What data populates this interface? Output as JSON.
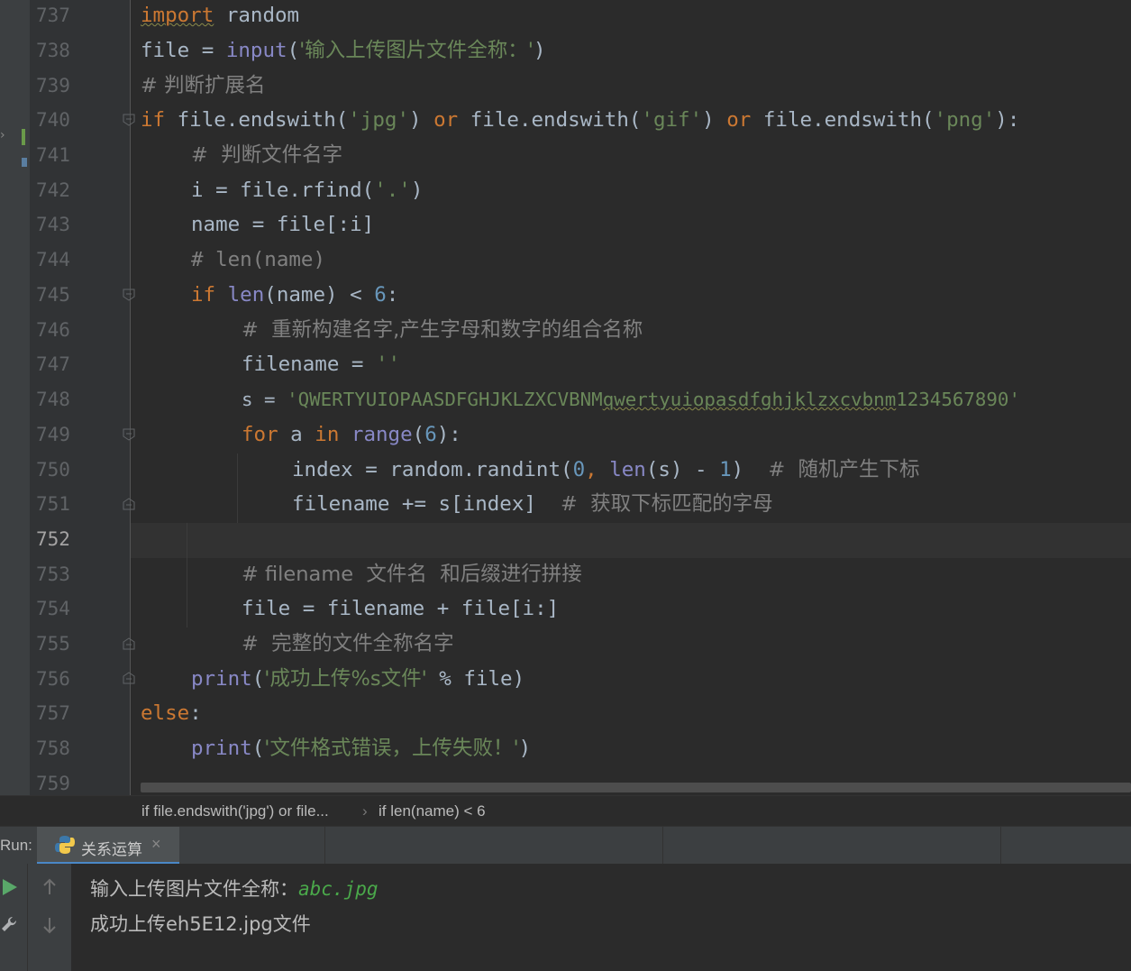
{
  "editor": {
    "line_numbers": [
      "737",
      "738",
      "739",
      "740",
      "741",
      "742",
      "743",
      "744",
      "745",
      "746",
      "747",
      "748",
      "749",
      "750",
      "751",
      "752",
      "753",
      "754",
      "755",
      "756",
      "757",
      "758",
      "759"
    ],
    "current_line": "752",
    "lines": {
      "l737": {
        "kw": "import",
        "rest": " random"
      },
      "l738": {
        "a": "file = ",
        "bi": "input",
        "b": "(",
        "str": "'输入上传图片文件全称：'",
        "c": ")"
      },
      "l739": {
        "cmt": "# 判断扩展名"
      },
      "l740": {
        "kw1": "if",
        "a": " file.endswith(",
        "s1": "'jpg'",
        "b": ") ",
        "kw2": "or",
        "c": " file.endswith(",
        "s2": "'gif'",
        "d": ") ",
        "kw3": "or",
        "e": " file.endswith(",
        "s3": "'png'",
        "f": "):"
      },
      "l741": {
        "cmt": "#  判断文件名字"
      },
      "l742": {
        "a": "i = file.rfind(",
        "str": "'.'",
        "b": ")"
      },
      "l743": {
        "a": "name = file[:i]"
      },
      "l744": {
        "cmt": "# len(name)"
      },
      "l745": {
        "kw": "if",
        "sp": " ",
        "bi": "len",
        "a": "(name) < ",
        "num": "6",
        "b": ":"
      },
      "l746": {
        "cmt": "#  重新构建名字,产生字母和数字的组合名称"
      },
      "l747": {
        "a": "filename = ",
        "str": "''"
      },
      "l748": {
        "a": "s = ",
        "str1": "'QWERTYUIOPAASDFGHJKLZXCVBNM",
        "str2": "qwertyuiopasdfghjklzxcvbnm",
        "str3": "1234567890'"
      },
      "l749": {
        "kw1": "for",
        "a": " a ",
        "kw2": "in",
        "sp": " ",
        "bi": "range",
        "b": "(",
        "num": "6",
        "c": "):"
      },
      "l750": {
        "a": "index = random.randint(",
        "n1": "0",
        "comma": ", ",
        "bi": "len",
        "b": "(s) - ",
        "n2": "1",
        "c": ")  ",
        "cmt": "#  随机产生下标"
      },
      "l751": {
        "a": "filename += s[index]  ",
        "cmt": "#  获取下标匹配的字母"
      },
      "l752": {},
      "l753": {
        "cmt": "# filename  文件名  和后缀进行拼接"
      },
      "l754": {
        "a": "file = filename + file[i:]"
      },
      "l755": {
        "cmt": "#  完整的文件全称名字"
      },
      "l756": {
        "bi": "print",
        "a": "(",
        "str": "'成功上传%s文件'",
        "b": " % file)"
      },
      "l757": {
        "kw": "else",
        "a": ":"
      },
      "l758": {
        "bi": "print",
        "a": "(",
        "str": "'文件格式错误，上传失败！'",
        "b": ")"
      }
    }
  },
  "breadcrumb": {
    "item1": "if file.endswith('jpg') or file...",
    "separator": "›",
    "item2": "if len(name) < 6"
  },
  "run": {
    "label": "Run:",
    "tab_label": "关系运算",
    "close": "×"
  },
  "console": {
    "prompt": "输入上传图片文件全称：",
    "input_value": "abc.jpg",
    "output": "成功上传eh5E12.jpg文件"
  },
  "colors": {
    "background": "#2b2b2b",
    "keyword": "#cc7832",
    "builtin": "#8888c6",
    "string": "#6a8759",
    "number": "#6897bb",
    "comment": "#808080",
    "text": "#a9b7c6",
    "console_input": "#4aa84a"
  },
  "icons": [
    "python-file-icon",
    "run-play-icon",
    "wrench-icon",
    "arrow-up-icon",
    "arrow-down-icon",
    "fold-marker-icon",
    "vcs-change-icon"
  ]
}
